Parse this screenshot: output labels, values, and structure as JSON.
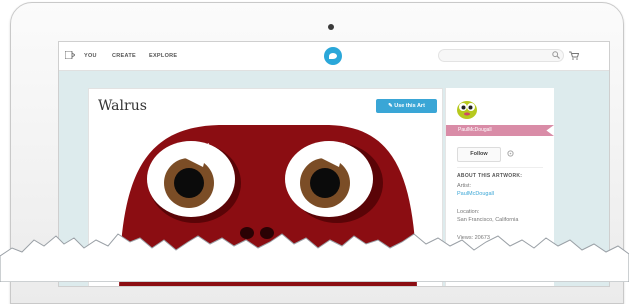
{
  "nav": {
    "items": [
      "YOU",
      "CREATE",
      "EXPLORE"
    ]
  },
  "artwork": {
    "title": "Walrus",
    "use_button_label": "Use this Art"
  },
  "artist": {
    "name": "PaulMcDougall",
    "follow_label": "Follow",
    "about_heading": "ABOUT THIS ARTWORK:",
    "artist_label": "Artist:",
    "artist_link": "PaulMcDougall",
    "location_label": "Location:",
    "location_value": "San Francisco, California",
    "views_text": "Views: 20673"
  },
  "colors": {
    "accent_blue": "#2aa7d9",
    "ribbon_pink": "#d98ca7",
    "artwork_red": "#8b0d12",
    "page_bg": "#ddebed"
  },
  "icons": [
    "menu-icon",
    "logo-bird-icon",
    "search-icon",
    "cart-icon",
    "pencil-icon",
    "gear-icon"
  ]
}
